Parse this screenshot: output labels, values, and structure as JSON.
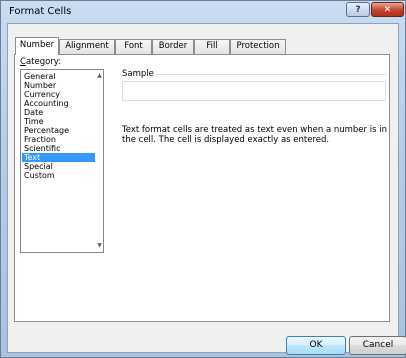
{
  "window": {
    "title": "Format Cells",
    "help_label": "?",
    "close_label": "✕"
  },
  "tabs": [
    {
      "label": "Number"
    },
    {
      "label": "Alignment"
    },
    {
      "label": "Font"
    },
    {
      "label": "Border"
    },
    {
      "label": "Fill"
    },
    {
      "label": "Protection"
    }
  ],
  "category": {
    "label_prefix": "C",
    "label_rest": "ategory:",
    "items": [
      "General",
      "Number",
      "Currency",
      "Accounting",
      "Date",
      "Time",
      "Percentage",
      "Fraction",
      "Scientific",
      "Text",
      "Special",
      "Custom"
    ],
    "selected": "Text"
  },
  "sample": {
    "label": "Sample",
    "value": ""
  },
  "description": "Text format cells are treated as text even when a number is in the cell. The cell is displayed exactly as entered.",
  "buttons": {
    "ok": "OK",
    "cancel": "Cancel"
  },
  "colors": {
    "selection": "#3399ff",
    "title_bg": "#b7cde8",
    "close_button": "#c0442b"
  }
}
